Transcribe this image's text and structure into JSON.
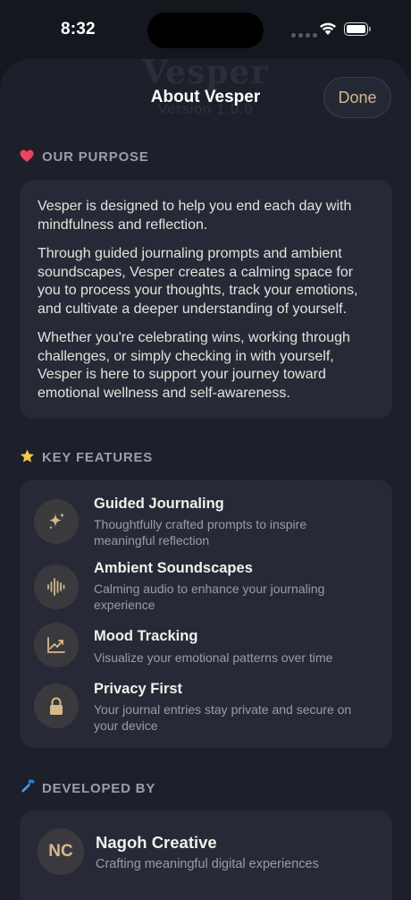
{
  "status_bar": {
    "time": "8:32"
  },
  "sheet": {
    "background_title": "Vesper",
    "background_version": "Version 1.0.0",
    "title": "About Vesper",
    "done_label": "Done"
  },
  "purpose": {
    "header": "OUR PURPOSE",
    "icon": "heart-icon",
    "paragraphs": [
      "Vesper is designed to help you end each day with mindfulness and reflection.",
      "Through guided journaling prompts and ambient soundscapes, Vesper creates a calming space for you to process your thoughts, track your emotions, and cultivate a deeper understanding of yourself.",
      "Whether you're celebrating wins, working through challenges, or simply checking in with yourself, Vesper is here to support your journey toward emotional wellness and self-awareness."
    ]
  },
  "features": {
    "header": "KEY FEATURES",
    "icon": "star-icon",
    "items": [
      {
        "icon": "sparkles-icon",
        "title": "Guided Journaling",
        "description": "Thoughtfully crafted prompts to inspire meaningful reflection"
      },
      {
        "icon": "waveform-icon",
        "title": "Ambient Soundscapes",
        "description": "Calming audio to enhance your journaling experience"
      },
      {
        "icon": "chart-icon",
        "title": "Mood Tracking",
        "description": "Visualize your emotional patterns over time"
      },
      {
        "icon": "lock-icon",
        "title": "Privacy First",
        "description": "Your journal entries stay private and secure on your device"
      }
    ]
  },
  "developer": {
    "header": "DEVELOPED BY",
    "icon": "hammer-icon",
    "initials": "NC",
    "name": "Nagoh Creative",
    "tagline": "Crafting meaningful digital experiences"
  },
  "colors": {
    "background": "#15171f",
    "sheet": "#1d202b",
    "card": "#272a36",
    "accent": "#d6b98a",
    "heart": "#f0435d",
    "star": "#f7c948",
    "hammer": "#4a9de8"
  }
}
